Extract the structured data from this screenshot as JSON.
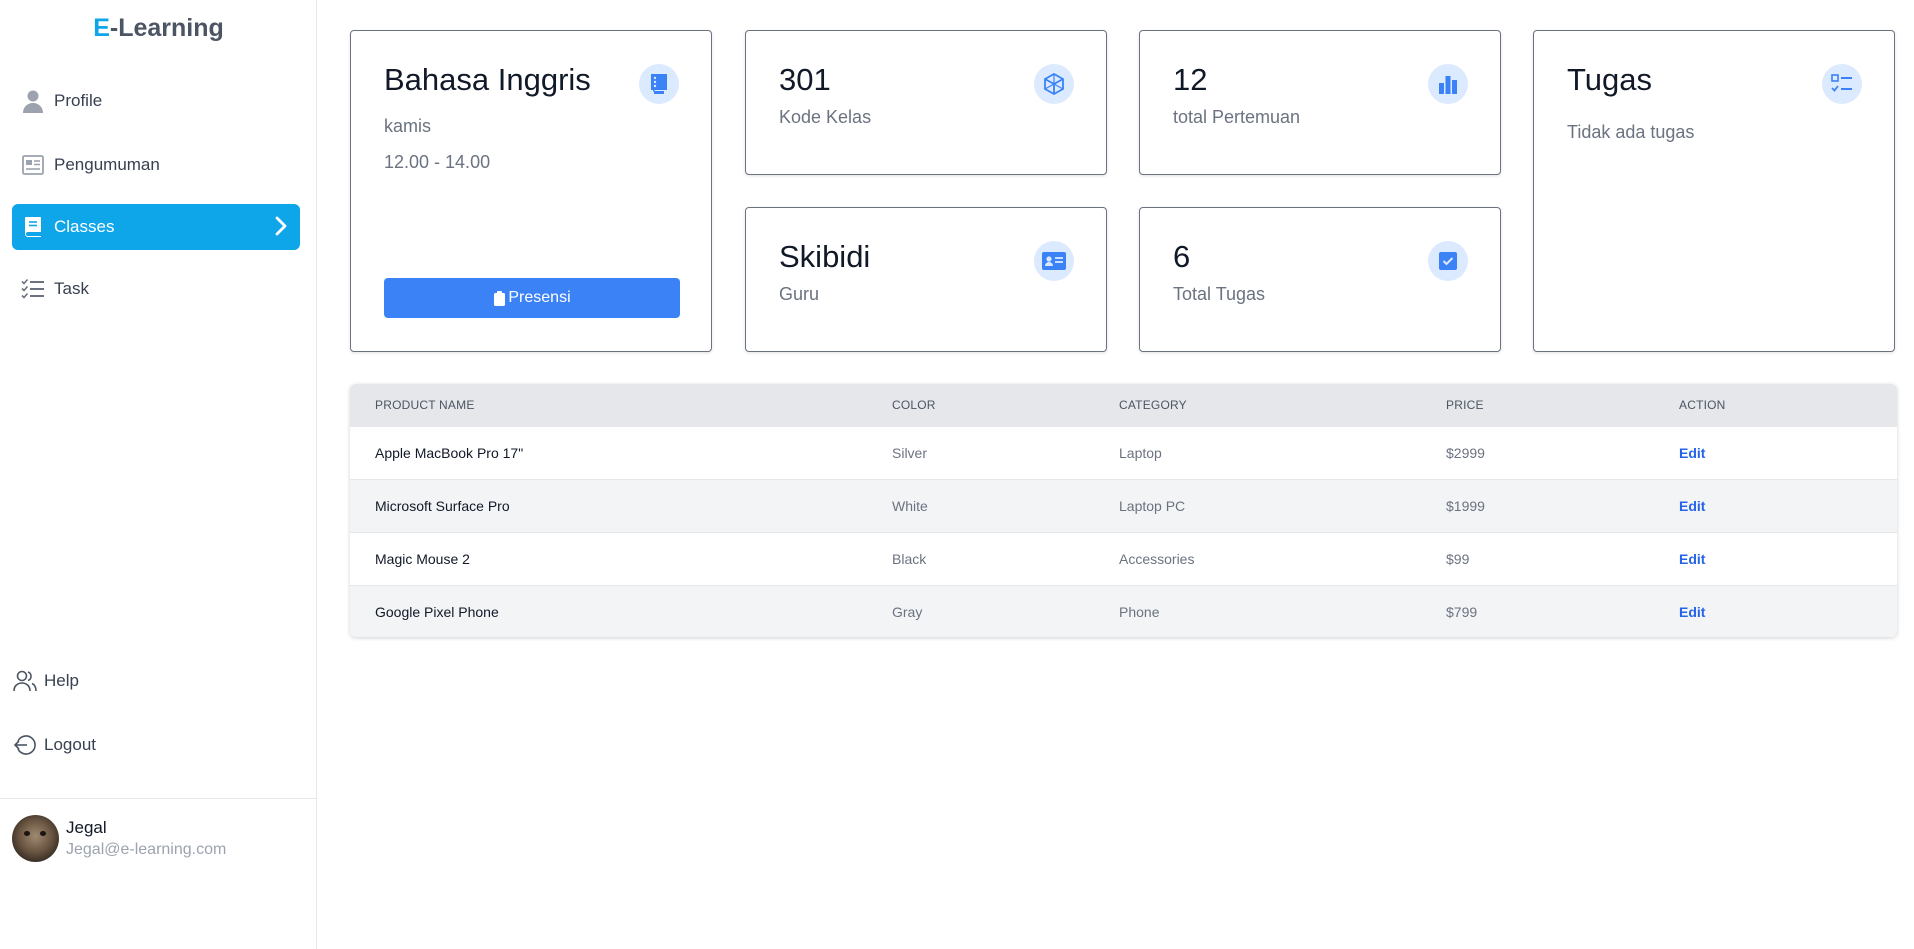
{
  "brand": {
    "accent": "E",
    "rest": "-Learning",
    "accent_color": "#0ea5e9"
  },
  "sidebar": {
    "items": [
      {
        "label": "Profile",
        "icon": "user-icon"
      },
      {
        "label": "Pengumuman",
        "icon": "newspaper-icon"
      },
      {
        "label": "Classes",
        "icon": "book-icon",
        "active": true
      },
      {
        "label": "Task",
        "icon": "list-check-icon"
      }
    ],
    "bottom": [
      {
        "label": "Help",
        "icon": "users-icon"
      },
      {
        "label": "Logout",
        "icon": "logout-icon"
      }
    ],
    "user": {
      "name": "Jegal",
      "email": "Jegal@e-learning.com"
    }
  },
  "cards": {
    "subject": {
      "title": "Bahasa Inggris",
      "day": "kamis",
      "time": "12.00 - 14.00",
      "button": "Presensi"
    },
    "class_code": {
      "value": "301",
      "label": "Kode Kelas"
    },
    "meetings": {
      "value": "12",
      "label": "total Pertemuan"
    },
    "tasks_panel": {
      "title": "Tugas",
      "empty": "Tidak ada tugas"
    },
    "teacher": {
      "value": "Skibidi",
      "label": "Guru"
    },
    "total_tasks": {
      "value": "6",
      "label": "Total Tugas"
    }
  },
  "table": {
    "headers": [
      "PRODUCT NAME",
      "COLOR",
      "CATEGORY",
      "PRICE",
      "ACTION"
    ],
    "rows": [
      {
        "name": "Apple MacBook Pro 17\"",
        "color": "Silver",
        "category": "Laptop",
        "price": "$2999",
        "action": "Edit"
      },
      {
        "name": "Microsoft Surface Pro",
        "color": "White",
        "category": "Laptop PC",
        "price": "$1999",
        "action": "Edit"
      },
      {
        "name": "Magic Mouse 2",
        "color": "Black",
        "category": "Accessories",
        "price": "$99",
        "action": "Edit"
      },
      {
        "name": "Google Pixel Phone",
        "color": "Gray",
        "category": "Phone",
        "price": "$799",
        "action": "Edit"
      }
    ]
  },
  "colors": {
    "primary": "#0ea5e9",
    "button": "#3b82f6",
    "icon_bg": "#dbeafe",
    "icon_fg": "#3b82f6"
  }
}
